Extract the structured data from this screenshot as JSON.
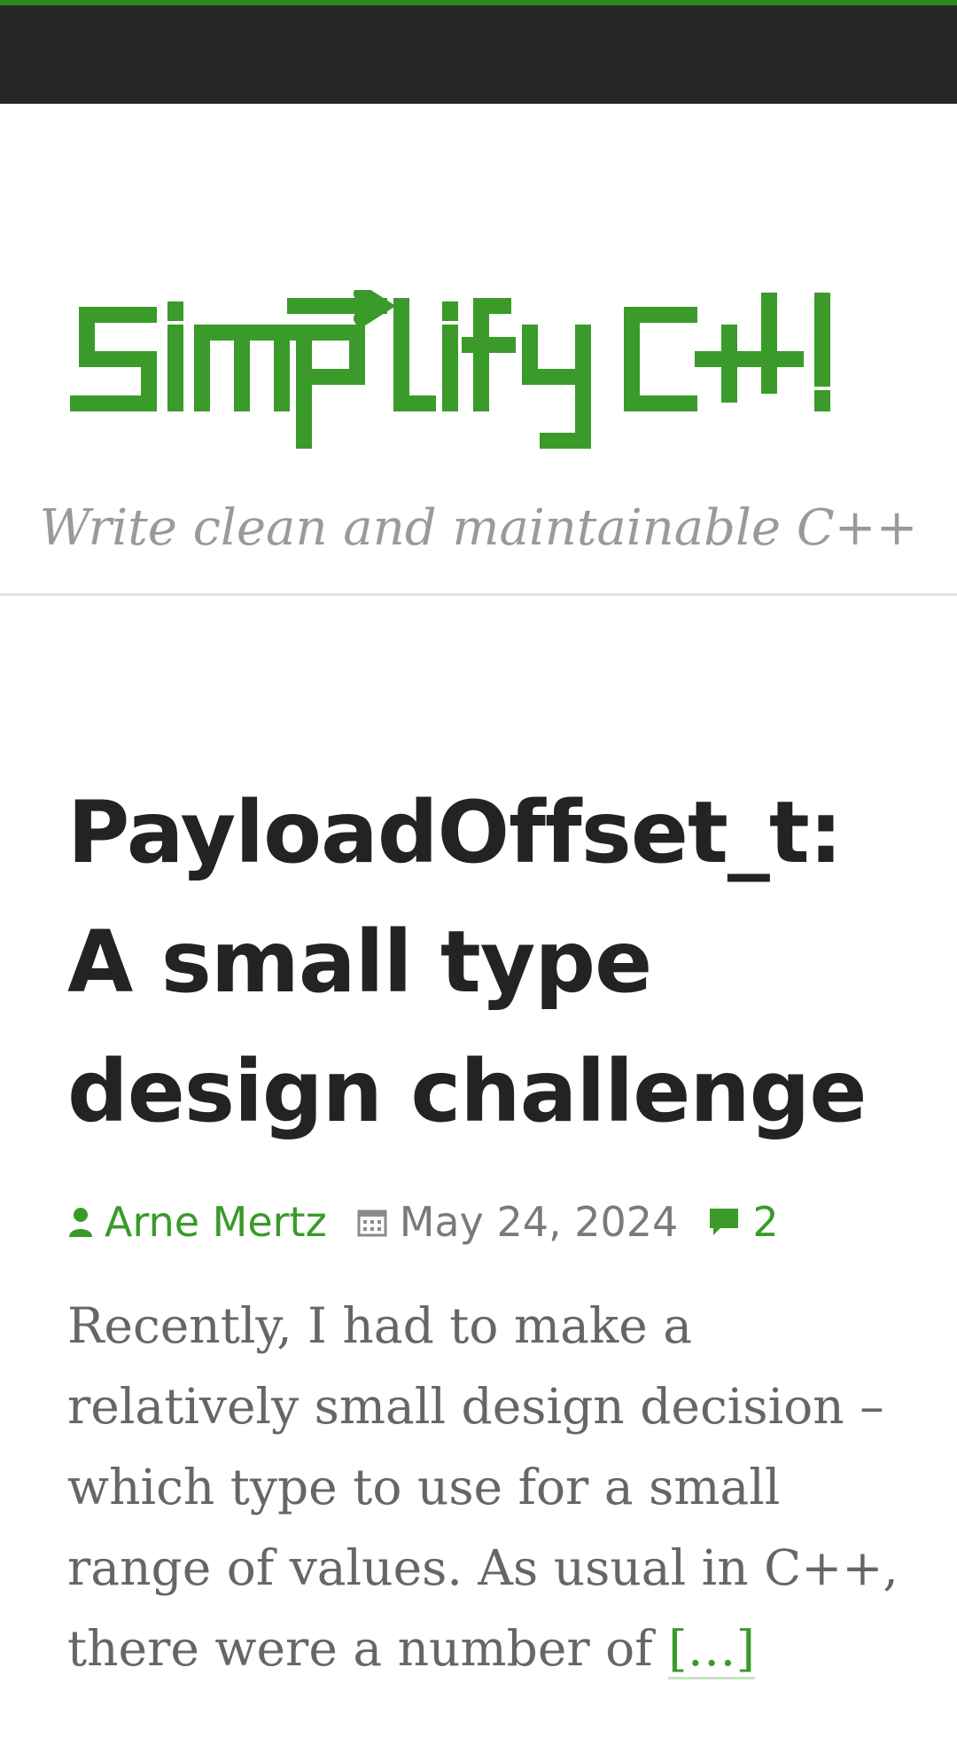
{
  "site": {
    "logo_text": "Simplify C++!",
    "tagline": "Write clean and maintainable C++"
  },
  "post": {
    "title": "PayloadOffset_t: A small type design challenge",
    "author": "Arne Mertz",
    "date": "May 24, 2024",
    "comment_count": "2",
    "excerpt": "Recently, I had to make a relatively small design decision – which type to use for a small range of values. As usual in C++, there were a number of",
    "read_more": "[…]"
  },
  "colors": {
    "accent": "#3a9a2a",
    "top_bar": "#262626",
    "top_accent": "#2a8a1e"
  },
  "icons": {
    "author": "person-icon",
    "date": "calendar-icon",
    "comments": "comment-icon"
  }
}
